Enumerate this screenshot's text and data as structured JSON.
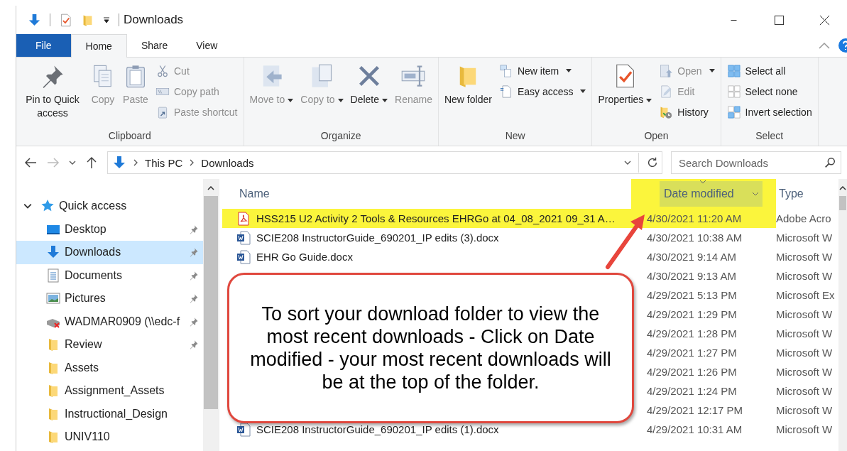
{
  "window": {
    "title": "Downloads"
  },
  "ribbon_tabs": [
    {
      "label": "File",
      "kind": "file",
      "selected": false
    },
    {
      "label": "Home",
      "kind": "tab",
      "selected": true
    },
    {
      "label": "Share",
      "kind": "tab",
      "selected": false
    },
    {
      "label": "View",
      "kind": "tab",
      "selected": false
    }
  ],
  "ribbon_groups": [
    {
      "label": "Clipboard",
      "large": [
        {
          "label": "Pin to Quick access",
          "kind": "pin",
          "disabled": false,
          "dropdown": false
        },
        {
          "label": "Copy",
          "kind": "copy",
          "disabled": true,
          "dropdown": false
        },
        {
          "label": "Paste",
          "kind": "paste",
          "disabled": true,
          "dropdown": false
        }
      ],
      "small": [
        {
          "label": "Cut",
          "kind": "cut",
          "disabled": true,
          "dropdown": false
        },
        {
          "label": "Copy path",
          "kind": "copypath",
          "disabled": true,
          "dropdown": false
        },
        {
          "label": "Paste shortcut",
          "kind": "pasteshortcut",
          "disabled": true,
          "dropdown": false
        }
      ]
    },
    {
      "label": "Organize",
      "large": [
        {
          "label": "Move to",
          "kind": "move",
          "disabled": true,
          "dropdown": true
        },
        {
          "label": "Copy to",
          "kind": "copyto",
          "disabled": true,
          "dropdown": true
        },
        {
          "label": "Delete",
          "kind": "delete",
          "disabled": false,
          "dropdown": true
        },
        {
          "label": "Rename",
          "kind": "rename",
          "disabled": true,
          "dropdown": false
        }
      ]
    },
    {
      "label": "New",
      "large": [
        {
          "label": "New folder",
          "kind": "newfolder",
          "disabled": false,
          "dropdown": false
        }
      ],
      "small": [
        {
          "label": "New item",
          "kind": "newitem",
          "disabled": false,
          "dropdown": true
        },
        {
          "label": "Easy access",
          "kind": "easyaccess",
          "disabled": false,
          "dropdown": true
        }
      ]
    },
    {
      "label": "Open",
      "large": [
        {
          "label": "Properties",
          "kind": "properties",
          "disabled": false,
          "dropdown": true
        }
      ],
      "small": [
        {
          "label": "Open",
          "kind": "open",
          "disabled": true,
          "dropdown": true
        },
        {
          "label": "Edit",
          "kind": "edit",
          "disabled": true,
          "dropdown": false
        },
        {
          "label": "History",
          "kind": "history",
          "disabled": false,
          "dropdown": false
        }
      ]
    },
    {
      "label": "Select",
      "small": [
        {
          "label": "Select all",
          "kind": "selectall",
          "disabled": false,
          "dropdown": false
        },
        {
          "label": "Select none",
          "kind": "selectnone",
          "disabled": false,
          "dropdown": false
        },
        {
          "label": "Invert selection",
          "kind": "invert",
          "disabled": false,
          "dropdown": false
        }
      ]
    }
  ],
  "address_bar": {
    "breadcrumbs": [
      "This PC",
      "Downloads"
    ]
  },
  "search": {
    "placeholder": "Search Downloads"
  },
  "sidebar": {
    "items": [
      {
        "label": "Quick access",
        "kind": "star",
        "expanded": true,
        "children": [
          {
            "label": "Desktop",
            "kind": "desktop",
            "pinned": true,
            "selected": false
          },
          {
            "label": "Downloads",
            "kind": "download",
            "pinned": true,
            "selected": true
          },
          {
            "label": "Documents",
            "kind": "documents",
            "pinned": true,
            "selected": false
          },
          {
            "label": "Pictures",
            "kind": "pictures",
            "pinned": true,
            "selected": false
          },
          {
            "label": "WADMAR0909 (\\\\edc-f",
            "kind": "netdrive",
            "pinned": true,
            "selected": false
          },
          {
            "label": "Review",
            "kind": "folder",
            "pinned": true,
            "selected": false
          },
          {
            "label": "Assets",
            "kind": "folder",
            "pinned": false,
            "selected": false
          },
          {
            "label": "Assignment_Assets",
            "kind": "folder",
            "pinned": false,
            "selected": false
          },
          {
            "label": "Instructional_Design",
            "kind": "folder",
            "pinned": false,
            "selected": false
          },
          {
            "label": "UNIV110",
            "kind": "folder",
            "pinned": false,
            "selected": false
          }
        ]
      }
    ]
  },
  "file_list": {
    "columns": [
      {
        "label": "Name",
        "sorted": false,
        "highlighted": false
      },
      {
        "label": "Date modified",
        "sorted": true,
        "highlighted": true
      },
      {
        "label": "Type",
        "sorted": false,
        "highlighted": false
      }
    ],
    "rows": [
      {
        "name": "HSS215 U2 Activity 2 Tools & Resources EHRGo at 04_08_2021 09_31 A…",
        "kind": "pdf",
        "date": "4/30/2021 11:20 AM",
        "type": "Adobe Acro",
        "highlighted": true
      },
      {
        "name": "SCIE208 InstructorGuide_690201_IP edits (3).docx",
        "kind": "word",
        "date": "4/30/2021 10:38 AM",
        "type": "Microsoft W",
        "highlighted": false
      },
      {
        "name": "EHR Go Guide.docx",
        "kind": "word",
        "date": "4/30/2021 9:14 AM",
        "type": "Microsoft W",
        "highlighted": false
      },
      {
        "date": "4/30/2021 9:13 AM",
        "type": "Microsoft W",
        "highlighted": false
      },
      {
        "date": "4/29/2021 5:13 PM",
        "type": "Microsoft Ex",
        "highlighted": false
      },
      {
        "date": "4/29/2021 1:29 PM",
        "type": "Microsoft W",
        "highlighted": false
      },
      {
        "date": "4/29/2021 1:28 PM",
        "type": "Microsoft W",
        "highlighted": false
      },
      {
        "date": "4/29/2021 1:27 PM",
        "type": "Microsoft W",
        "highlighted": false
      },
      {
        "date": "4/29/2021 1:26 PM",
        "type": "Microsoft W",
        "highlighted": false
      },
      {
        "date": "4/29/2021 1:24 PM",
        "type": "Microsoft W",
        "highlighted": false
      },
      {
        "date": "4/29/2021 12:17 PM",
        "type": "Microsoft W",
        "highlighted": false
      },
      {
        "name": "SCIE208 InstructorGuide_690201_IP edits (1).docx",
        "kind": "word",
        "date": "4/29/2021 10:31 AM",
        "type": "Microsoft W",
        "highlighted": false
      }
    ]
  },
  "callout": {
    "text": "To sort your download folder to view the most recent downloads - Click on Date modified - your most recent downloads will be at the top of the folder."
  }
}
